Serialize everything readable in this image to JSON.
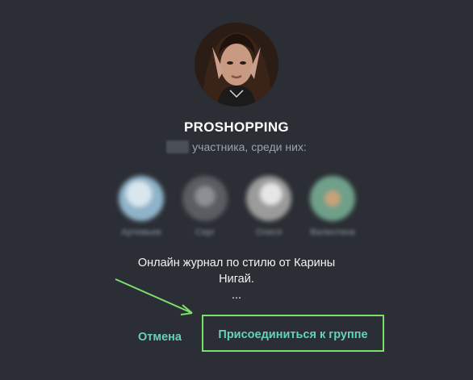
{
  "group": {
    "title": "PROSHOPPING",
    "members_text": "участника, среди них:",
    "description_line1": "Онлайн журнал по стилю от Карины",
    "description_line2": "Нигай.",
    "description_more": "..."
  },
  "members": [
    {
      "name": "Артемьев",
      "color": "#8fb3c9"
    },
    {
      "name": "Серг",
      "color": "#6b6f75"
    },
    {
      "name": "Олеся",
      "color": "#9b9b9b"
    },
    {
      "name": "Валентина",
      "color": "#6fa08a"
    }
  ],
  "actions": {
    "cancel_label": "Отмена",
    "join_label": "Присоединиться к группе"
  },
  "annotation": {
    "highlight_color": "#7ddf6b"
  }
}
